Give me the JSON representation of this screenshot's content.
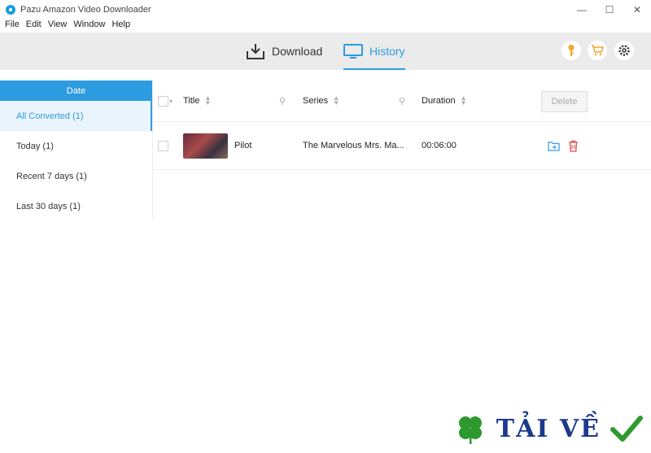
{
  "window": {
    "title": "Pazu Amazon Video Downloader",
    "minimize": "—",
    "maximize": "☐",
    "close": "✕"
  },
  "menu": [
    "File",
    "Edit",
    "View",
    "Window",
    "Help"
  ],
  "tabs": {
    "download": "Download",
    "history": "History"
  },
  "sidebar": {
    "header": "Date",
    "items": [
      "All Converted (1)",
      "Today (1)",
      "Recent 7 days (1)",
      "Last 30 days (1)"
    ]
  },
  "table": {
    "headers": {
      "title": "Title",
      "series": "Series",
      "duration": "Duration"
    },
    "delete_label": "Delete",
    "rows": [
      {
        "title": "Pilot",
        "series": "The Marvelous Mrs. Ma...",
        "duration": "00:06:00"
      }
    ]
  },
  "colors": {
    "accent": "#2d9be0",
    "key": "#f5a623",
    "cart": "#f5a623",
    "trash": "#e04a4a"
  },
  "watermark": {
    "text": "TẢI VỀ"
  }
}
